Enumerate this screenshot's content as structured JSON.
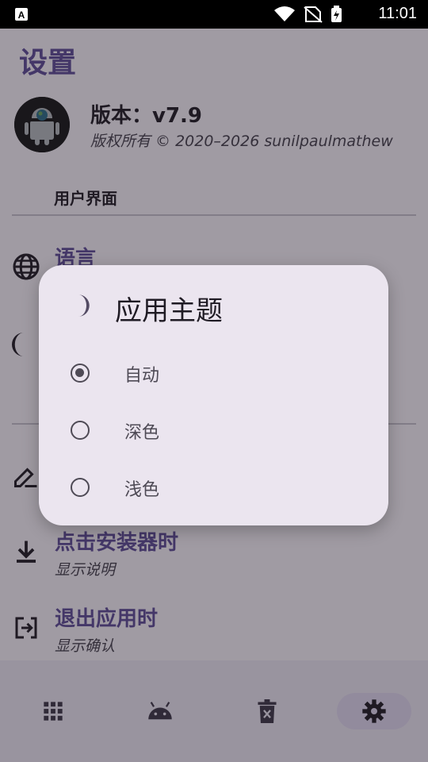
{
  "status_bar": {
    "time": "11:01",
    "icons": [
      "text-a-icon",
      "wifi-icon",
      "no-sim-icon",
      "battery-charging-icon"
    ]
  },
  "page": {
    "title": "设置",
    "version_title": "版本：v7.9",
    "copyright": "版权所有 © 2020–2026 sunilpaulmathew"
  },
  "sections": {
    "ui_label": "用户界面"
  },
  "rows": {
    "language_title": "语言",
    "installer_title": "点击安装器时",
    "installer_sub": "显示说明",
    "exit_title": "退出应用时",
    "exit_sub": "显示确认"
  },
  "bottom_nav": {
    "items": [
      "apps",
      "android",
      "uninstall",
      "settings"
    ],
    "active": "settings"
  },
  "dialog": {
    "title": "应用主题",
    "options": [
      {
        "label": "自动",
        "selected": true
      },
      {
        "label": "深色",
        "selected": false
      },
      {
        "label": "浅色",
        "selected": false
      }
    ]
  },
  "colors": {
    "accent": "#5f4d99",
    "background": "#fdf8ff",
    "dialog_bg": "#ebe5ef",
    "scrim": "rgba(31,27,36,0.42)"
  }
}
